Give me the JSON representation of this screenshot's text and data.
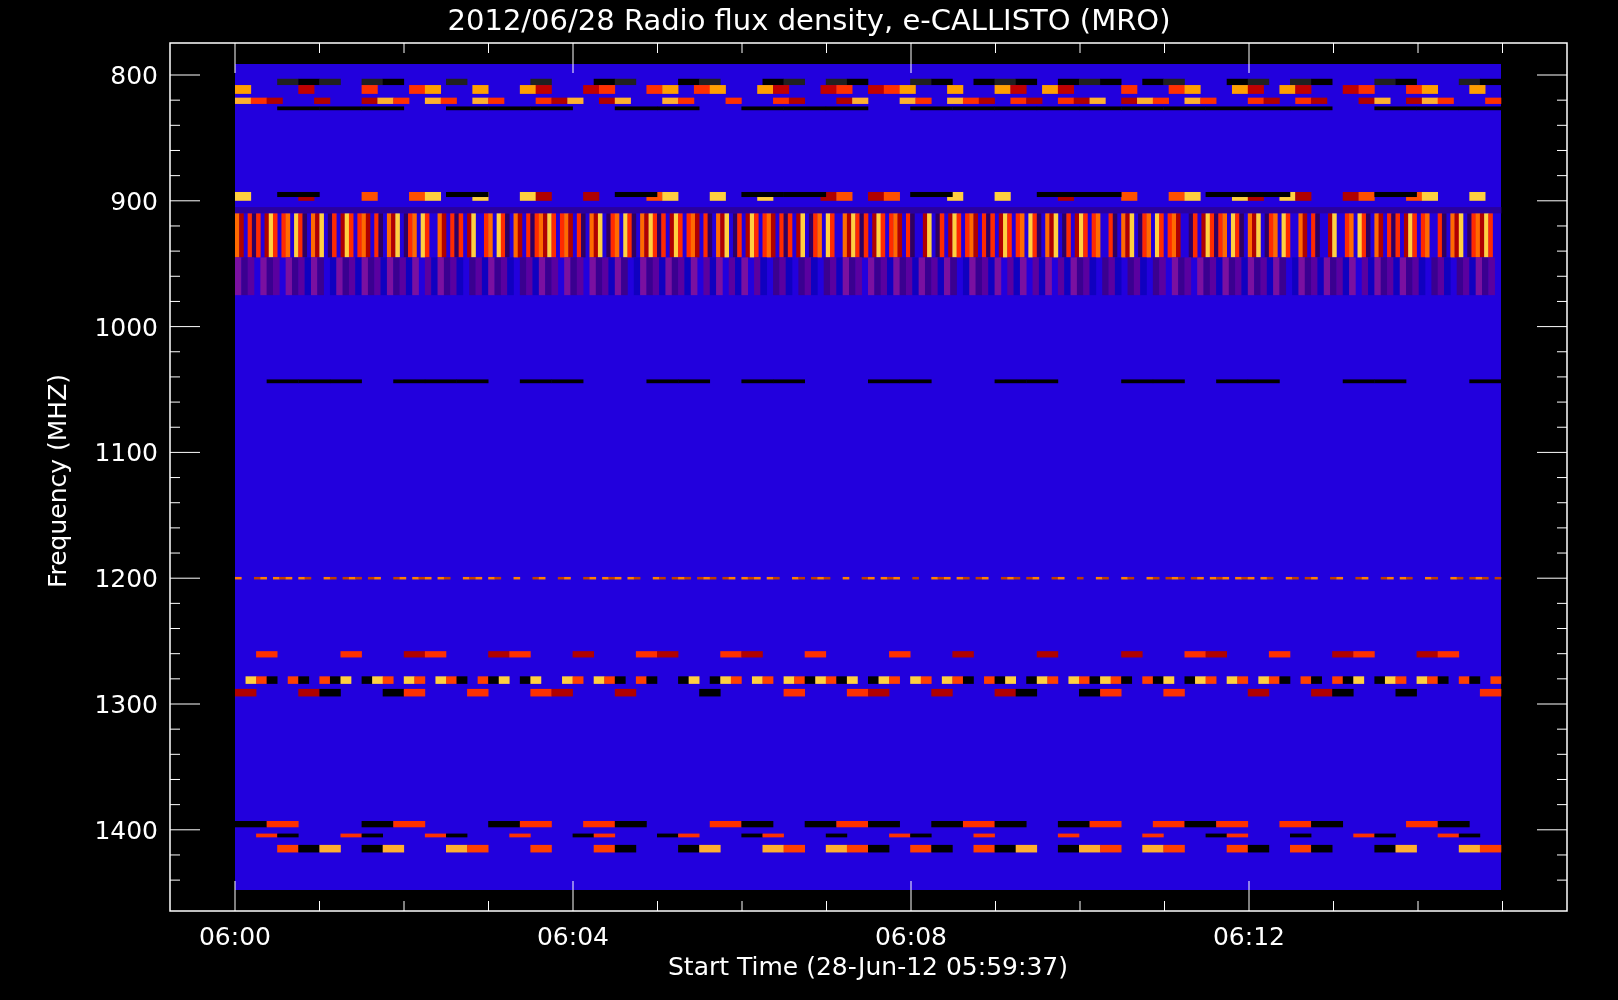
{
  "title": "2012/06/28  Radio flux density, e-CALLISTO (MRO)",
  "y_axis": {
    "label": "Frequency (MHZ)",
    "ticks": [
      "800",
      "900",
      "1000",
      "1100",
      "1200",
      "1300",
      "1400"
    ]
  },
  "x_axis": {
    "label": "Start Time (28-Jun-12 05:59:37)",
    "ticks": [
      "06:00",
      "06:04",
      "06:08",
      "06:12"
    ]
  }
}
